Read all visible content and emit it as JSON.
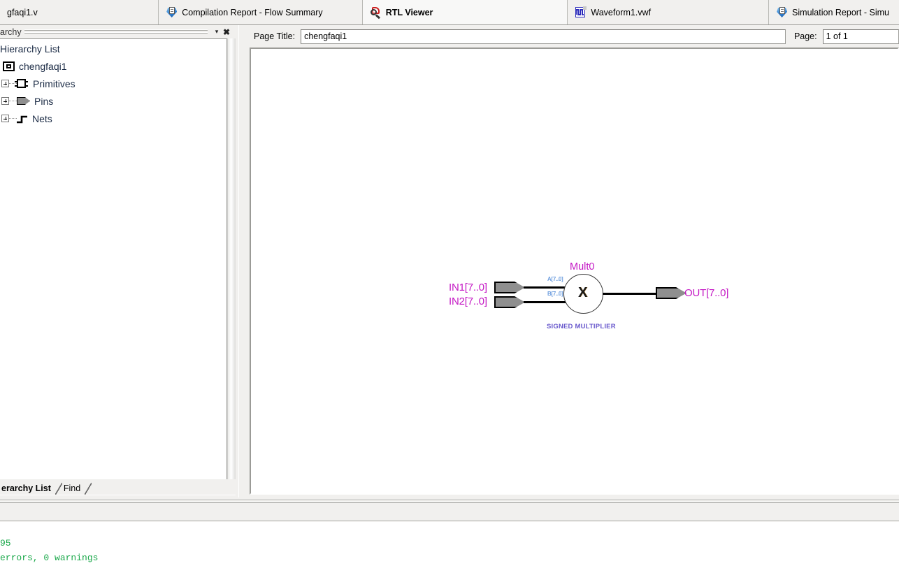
{
  "tabs": [
    {
      "label": "gfaqi1.v",
      "icon": "verilog-file-icon",
      "active": false,
      "has_icon": false
    },
    {
      "label": "Compilation Report - Flow Summary",
      "icon": "report-icon",
      "active": false,
      "has_icon": true
    },
    {
      "label": "RTL Viewer",
      "icon": "rtl-viewer-icon",
      "active": true,
      "has_icon": true
    },
    {
      "label": "Waveform1.vwf",
      "icon": "waveform-icon",
      "active": false,
      "has_icon": true
    },
    {
      "label": "Simulation Report - Simu",
      "icon": "report-icon",
      "active": false,
      "has_icon": true
    }
  ],
  "hierarchy_panel": {
    "title": "archy",
    "dropdown_icon": "chevron-down-icon",
    "close_icon": "close-icon",
    "list_header": "Hierarchy List",
    "root": {
      "label": "chengfaqi1",
      "icon": "module-icon"
    },
    "nodes": [
      {
        "label": "Primitives",
        "icon": "primitive-icon",
        "expander": "plus"
      },
      {
        "label": "Pins",
        "icon": "pin-icon",
        "expander": "plus"
      },
      {
        "label": "Nets",
        "icon": "net-icon",
        "expander": "plus"
      }
    ],
    "bottom_tabs": [
      {
        "label": "erarchy List",
        "active": true
      },
      {
        "label": "Find",
        "active": false
      }
    ]
  },
  "toolbar": {
    "page_title_label": "Page Title:",
    "page_title_value": "chengfaqi1",
    "page_label": "Page:",
    "page_value": "1 of 1"
  },
  "schematic": {
    "instance_name": "Mult0",
    "instance_type": "SIGNED MULTIPLIER",
    "operator_glyph": "X",
    "input_ports": [
      {
        "name": "IN1[7..0]",
        "bus_label": "A[7..0]"
      },
      {
        "name": "IN2[7..0]",
        "bus_label": "B[7..0]"
      }
    ],
    "output_ports": [
      {
        "name": "OUT[7..0]"
      }
    ],
    "colors": {
      "port_label": "#c418c4",
      "bus_label": "#6f9fdf",
      "type_label": "#6a5acd",
      "pin_fill": "#8f8f8f",
      "wire": "#000000"
    }
  },
  "messages": {
    "lines": [
      "95",
      "errors, 0 warnings"
    ],
    "text_color": "#1aa84a"
  }
}
